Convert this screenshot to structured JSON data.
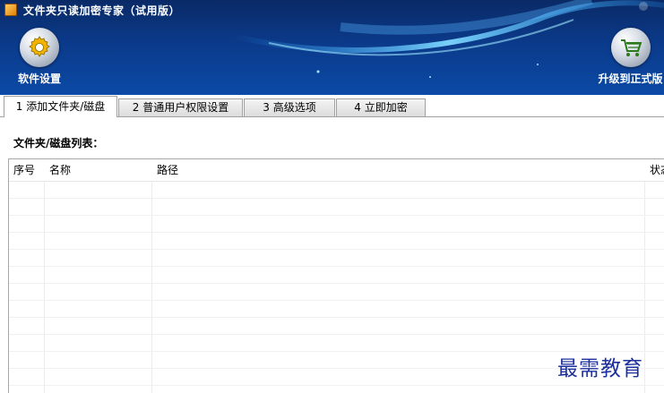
{
  "window": {
    "title": "文件夹只读加密专家（试用版）"
  },
  "toolbar": {
    "settings_label": "软件设置",
    "upgrade_label": "升级到正式版"
  },
  "tabs": [
    {
      "label": "1 添加文件夹/磁盘",
      "active": true
    },
    {
      "label": "2 普通用户权限设置",
      "active": false
    },
    {
      "label": "3 高级选项",
      "active": false
    },
    {
      "label": "4 立即加密",
      "active": false
    }
  ],
  "main": {
    "list_label": "文件夹/磁盘列表：",
    "columns": [
      "序号",
      "名称",
      "路径",
      "状态"
    ],
    "rows": []
  },
  "watermark": "最需教育",
  "colors": {
    "header_dark": "#0a2a66",
    "header_light": "#0b4aa6",
    "watermark": "#1c2f9c"
  }
}
